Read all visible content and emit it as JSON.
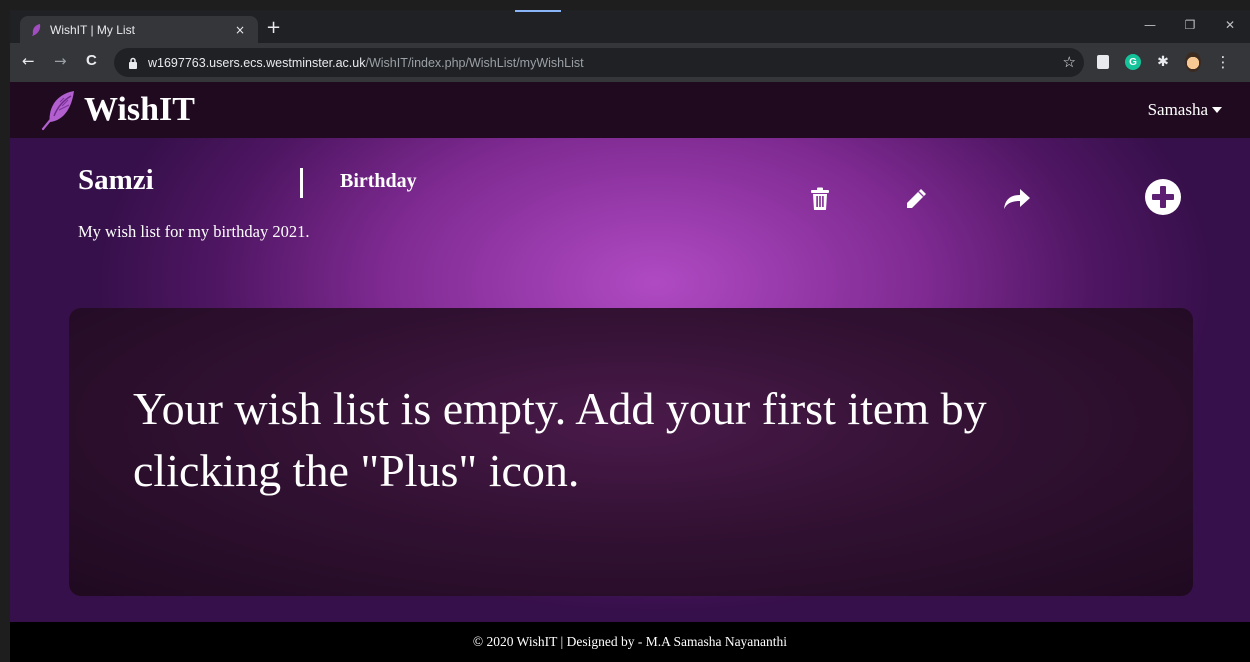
{
  "browser": {
    "tab_title": "WishIT | My List",
    "tab_close": "×",
    "new_tab": "+",
    "nav_back": "←",
    "nav_forward": "→",
    "nav_reload": "C",
    "url_host": "w1697763.users.ecs.westminster.ac.uk",
    "url_path": "/WishIT/index.php/WishList/myWishList",
    "bookmark": "☆",
    "menu": "⋮",
    "grammarly": "G",
    "win_minimize": "—",
    "win_restore": "❐",
    "win_close": "✕"
  },
  "header": {
    "logo_text": "WishIT",
    "user_name": "Samasha"
  },
  "wishlist": {
    "title": "Samzi",
    "occasion": "Birthday",
    "description": "My wish list for my birthday 2021.",
    "empty_message": "Your wish list is empty. Add your first item by clicking the \"Plus\" icon."
  },
  "footer": {
    "text": "© 2020 WishIT | Designed by - M.A Samasha Nayananthi"
  },
  "colors": {
    "accent": "#b04ac3",
    "header_bg": "#1f0a1f",
    "panel_bg": "#2a0e2b",
    "footer_bg": "#000000"
  }
}
